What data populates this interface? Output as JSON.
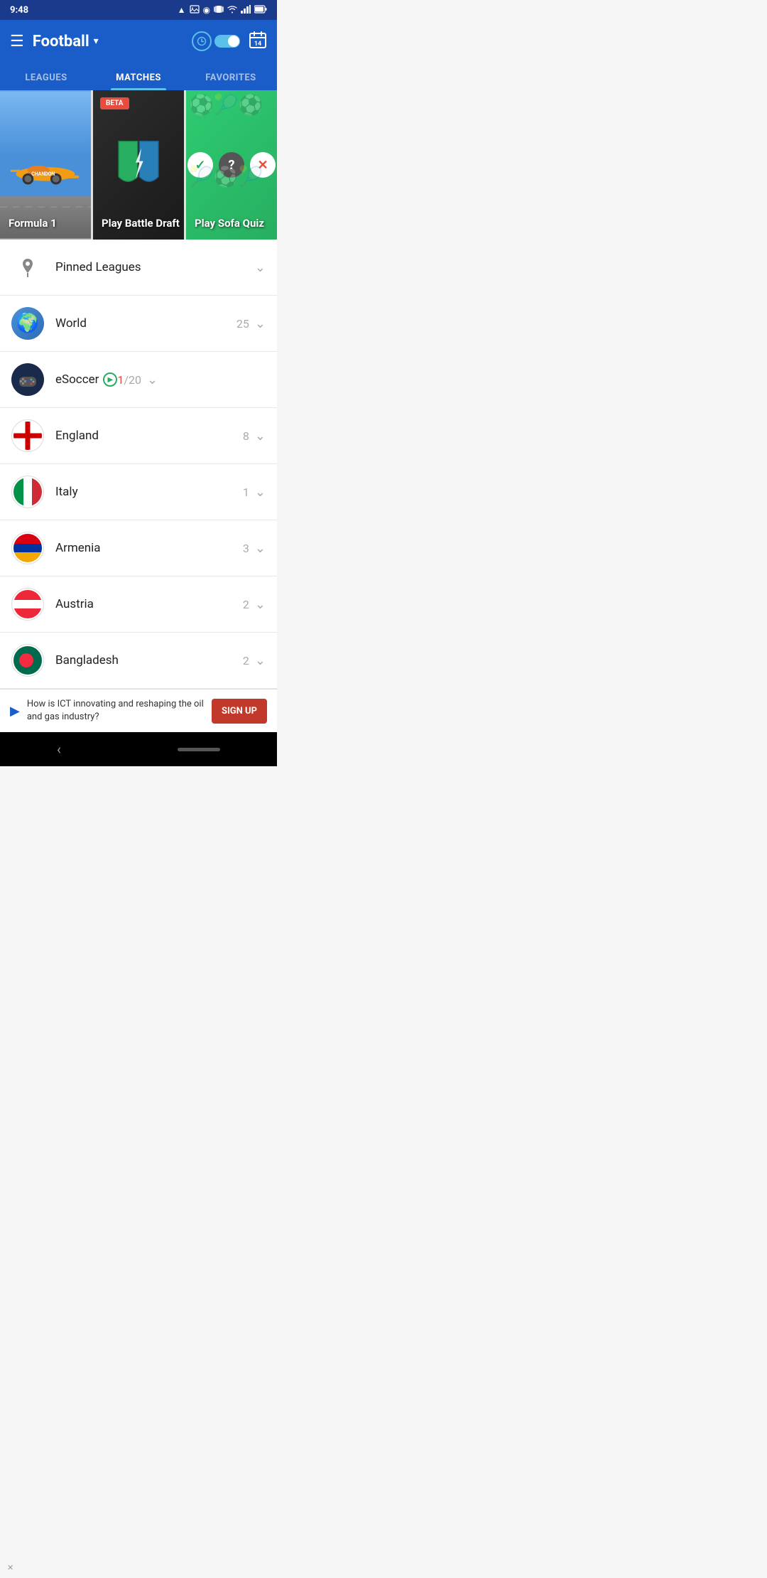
{
  "statusBar": {
    "time": "9:48",
    "icons": [
      "drive-icon",
      "image-icon",
      "circle-icon",
      "vibrate-icon",
      "wifi-icon",
      "signal-icon",
      "battery-icon"
    ]
  },
  "appBar": {
    "menuLabel": "☰",
    "title": "Football",
    "dropdownArrow": "▼",
    "calendarBadge": "14"
  },
  "tabs": [
    {
      "label": "LEAGUES",
      "active": false
    },
    {
      "label": "MATCHES",
      "active": true
    },
    {
      "label": "FAVORITES",
      "active": false
    }
  ],
  "bannerCards": [
    {
      "id": "formula1",
      "label": "Formula 1",
      "badge": null
    },
    {
      "id": "battleDraft",
      "label": "Play Battle Draft",
      "badge": "BETA"
    },
    {
      "id": "sofaQuiz",
      "label": "Play Sofa Quiz",
      "badge": null
    }
  ],
  "listItems": [
    {
      "id": "pinned",
      "icon": "pin",
      "label": "Pinned Leagues",
      "count": "",
      "live": false,
      "isPinned": true
    },
    {
      "id": "world",
      "icon": "world",
      "label": "World",
      "count": "25",
      "live": false,
      "isPinned": false
    },
    {
      "id": "esoccer",
      "icon": "esoccer",
      "label": "eSoccer",
      "countLive": "1",
      "countTotal": "20",
      "live": true,
      "isPinned": false
    },
    {
      "id": "england",
      "icon": "england",
      "label": "England",
      "count": "8",
      "live": false,
      "isPinned": false
    },
    {
      "id": "italy",
      "icon": "italy",
      "label": "Italy",
      "count": "1",
      "live": false,
      "isPinned": false
    },
    {
      "id": "armenia",
      "icon": "armenia",
      "label": "Armenia",
      "count": "3",
      "live": false,
      "isPinned": false
    },
    {
      "id": "austria",
      "icon": "austria",
      "label": "Austria",
      "count": "2",
      "live": false,
      "isPinned": false
    },
    {
      "id": "bangladesh",
      "icon": "bangladesh",
      "label": "Bangladesh",
      "count": "2",
      "live": false,
      "isPinned": false
    }
  ],
  "adBanner": {
    "text": "How is ICT innovating and reshaping the oil and gas industry?",
    "buttonLabel": "SIGN UP"
  },
  "colors": {
    "primary": "#1a5dc8",
    "accent": "#5bc0eb",
    "live": "#e74c3c",
    "green": "#27ae60"
  }
}
